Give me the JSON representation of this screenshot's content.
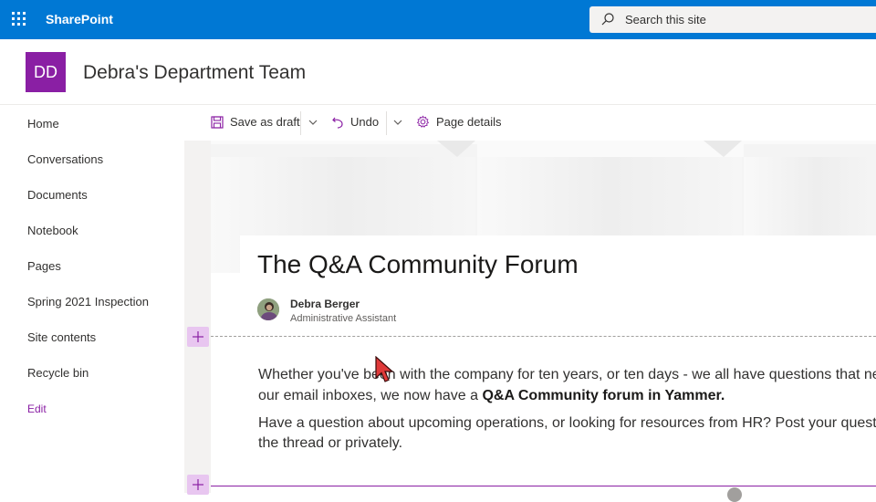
{
  "suite": {
    "app_name": "SharePoint",
    "search_placeholder": "Search this site",
    "brand_color": "#0078d4"
  },
  "site": {
    "logo_initials": "DD",
    "logo_color": "#8a1fa4",
    "title": "Debra's Department Team"
  },
  "nav": {
    "items": [
      {
        "label": "Home"
      },
      {
        "label": "Conversations"
      },
      {
        "label": "Documents"
      },
      {
        "label": "Notebook"
      },
      {
        "label": "Pages"
      },
      {
        "label": "Spring 2021 Inspection"
      },
      {
        "label": "Site contents"
      },
      {
        "label": "Recycle bin"
      }
    ],
    "edit_label": "Edit"
  },
  "commandbar": {
    "save_label": "Save as draft",
    "undo_label": "Undo",
    "details_label": "Page details"
  },
  "page": {
    "title": "The Q&A Community Forum",
    "author_name": "Debra Berger",
    "author_role": "Administrative Assistant",
    "para1_line1": "Whether you've been with the company for ten years, or ten days - we all have questions that ne",
    "para1_line2_prefix": "our email inboxes, we now have a ",
    "para1_line2_bold": "Q&A Community forum in Yammer.",
    "para2_line1": "Have a question about upcoming operations, or looking for resources from HR?  Post your quest",
    "para2_line2": "the thread or privately."
  }
}
